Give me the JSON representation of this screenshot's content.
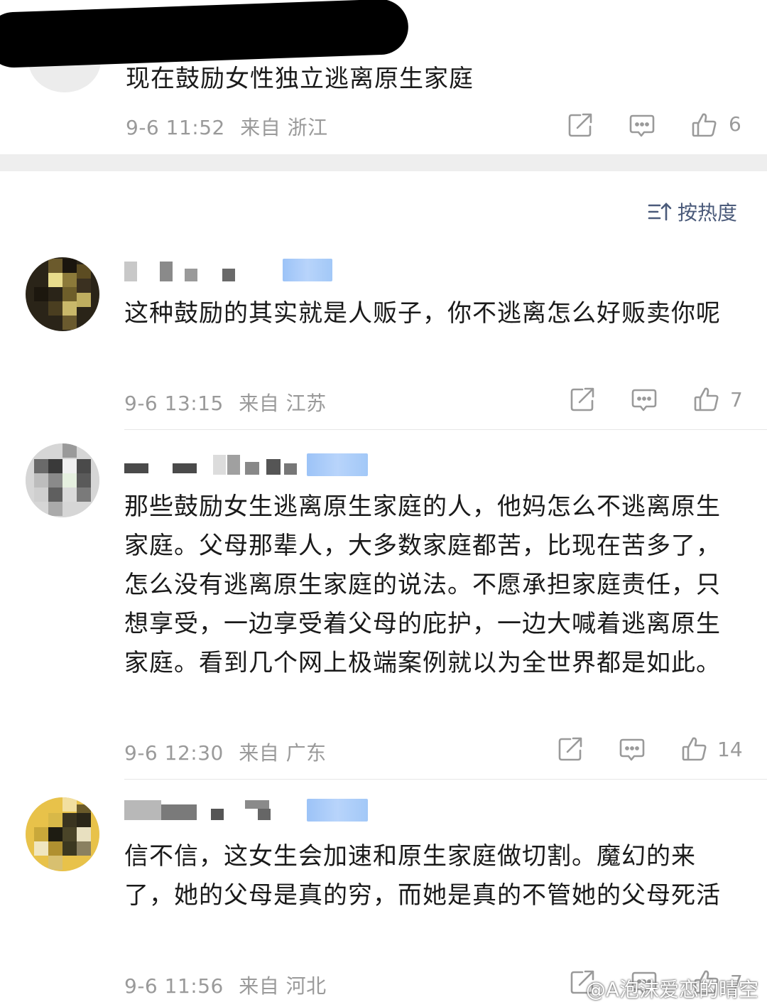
{
  "top_post": {
    "text": "现在鼓励女性独立逃离原生家庭",
    "time": "9-6 11:52",
    "source": "来自 浙江",
    "like_count": "6"
  },
  "sort": {
    "label": "按热度"
  },
  "comments": [
    {
      "text": "这种鼓励的其实就是人贩子，你不逃离怎么好贩卖你呢",
      "time": "9-6 13:15",
      "source": "来自 江苏",
      "like_count": "7"
    },
    {
      "text": "那些鼓励女生逃离原生家庭的人，他妈怎么不逃离原生家庭。父母那辈人，大多数家庭都苦，比现在苦多了，怎么没有逃离原生家庭的说法。不愿承担家庭责任，只想享受，一边享受着父母的庇护，一边大喊着逃离原生家庭。看到几个网上极端案例就以为全世界都是如此。",
      "time": "9-6 12:30",
      "source": "来自 广东",
      "like_count": "14"
    },
    {
      "text": "信不信，这女生会加速和原生家庭做切割。魔幻的来了，她的父母是真的穷，而她是真的不管她的父母死活",
      "time": "9-6 11:56",
      "source": "来自 河北",
      "like_count": "7"
    }
  ],
  "icons": {
    "share": "share-icon",
    "comment": "comment-icon",
    "like": "thumbs-up-icon",
    "sort": "sort-icon"
  },
  "colors": {
    "meta": "#9a9a9a",
    "sort": "#4a5a7a",
    "badge": "#a9cbf7"
  },
  "watermark": "@A泡沫爱恋的晴空"
}
